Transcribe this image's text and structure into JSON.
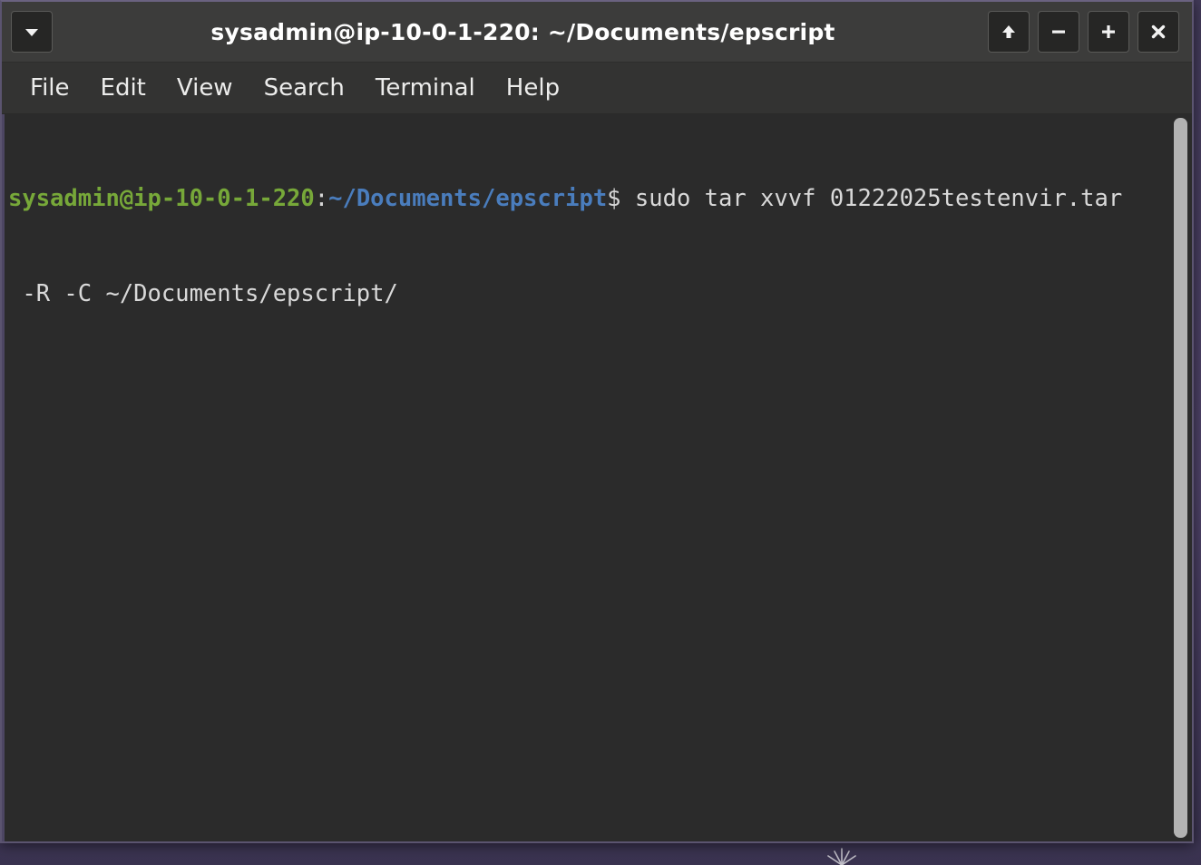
{
  "window": {
    "title": "sysadmin@ip-10-0-1-220: ~/Documents/epscript",
    "menu_button_icon": "chevron-down-icon",
    "controls": [
      {
        "name": "shade-window-button",
        "icon": "up-arrow-icon",
        "label": "↑"
      },
      {
        "name": "minimize-window-button",
        "icon": "minus-icon",
        "label": "–"
      },
      {
        "name": "maximize-window-button",
        "icon": "plus-icon",
        "label": "+"
      },
      {
        "name": "close-window-button",
        "icon": "close-icon",
        "label": "×"
      }
    ]
  },
  "menubar": {
    "items": [
      {
        "label": "File"
      },
      {
        "label": "Edit"
      },
      {
        "label": "View"
      },
      {
        "label": "Search"
      },
      {
        "label": "Terminal"
      },
      {
        "label": "Help"
      }
    ]
  },
  "terminal": {
    "prompt": {
      "user_host": "sysadmin@ip-10-0-1-220",
      "separator": ":",
      "path": "~/Documents/epscript",
      "sigil": "$"
    },
    "command_line1": " sudo tar xvvf 01222025testenvir.tar",
    "command_line2": " -R -C ~/Documents/epscript/",
    "scrollbar": {
      "name": "terminal-scrollbar",
      "thumb_position": "top",
      "thumb_fraction": 1.0
    }
  },
  "colors": {
    "titlebar_bg": "#3c3c3b",
    "menubar_bg": "#333332",
    "terminal_bg": "#2b2b2b",
    "prompt_green": "#77a839",
    "path_blue": "#4a7dbd",
    "text_gray": "#d6d6d6",
    "scrollbar_thumb": "#b3b3b3",
    "desktop_purple": "#4a3f63",
    "window_border": "#5b5470"
  }
}
